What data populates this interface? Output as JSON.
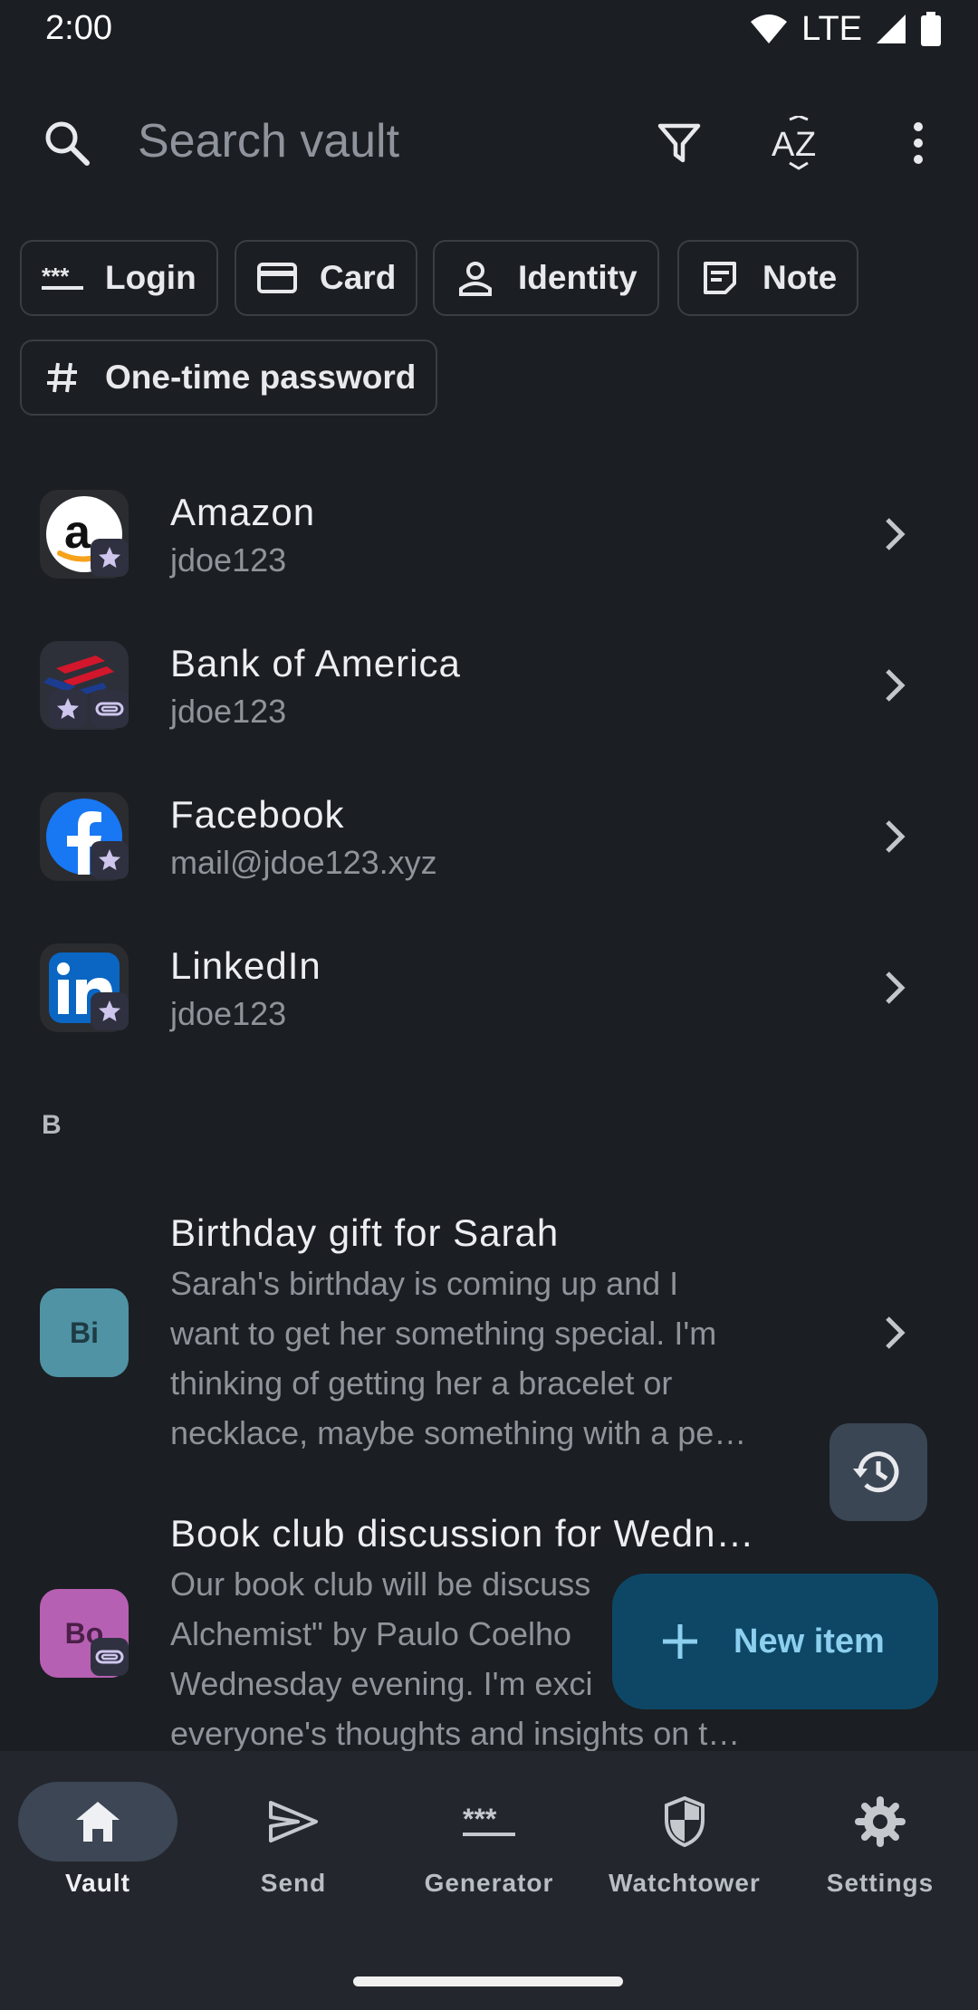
{
  "status_bar": {
    "time": "2:00",
    "network": "LTE"
  },
  "search": {
    "placeholder": "Search vault"
  },
  "toolbar": {
    "filter_icon": "filter-icon",
    "sort_icon": "sort-az-icon",
    "menu_icon": "more-vert-icon"
  },
  "chips": [
    {
      "label": "Login",
      "icon": "password-dots-icon"
    },
    {
      "label": "Card",
      "icon": "credit-card-icon"
    },
    {
      "label": "Identity",
      "icon": "person-icon"
    },
    {
      "label": "Note",
      "icon": "sticky-note-icon"
    },
    {
      "label": "One-time password",
      "icon": "hash-icon"
    }
  ],
  "logins": [
    {
      "title": "Amazon",
      "subtitle": "jdoe123",
      "icon": "amazon-logo",
      "favorite": true,
      "attachment": false
    },
    {
      "title": "Bank of America",
      "subtitle": "jdoe123",
      "icon": "bank-of-america-logo",
      "favorite": true,
      "attachment": true
    },
    {
      "title": "Facebook",
      "subtitle": "mail@jdoe123.xyz",
      "icon": "facebook-logo",
      "favorite": true,
      "attachment": false
    },
    {
      "title": "LinkedIn",
      "subtitle": "jdoe123",
      "icon": "linkedin-logo",
      "favorite": true,
      "attachment": false
    }
  ],
  "section_header": "B",
  "notes": [
    {
      "title": "Birthday gift for Sarah",
      "avatar": "Bi",
      "avatar_color": "#4f93a4",
      "lines": [
        "Sarah's birthday is coming up and I",
        "want to get her something special. I'm",
        "thinking of getting her a bracelet or",
        "necklace, maybe something with a pe…"
      ]
    },
    {
      "title": "Book club discussion for Wedn…",
      "avatar": "Bo",
      "avatar_color": "#b660b3",
      "lines": [
        "Our book club will be discuss",
        "Alchemist\" by Paulo Coelho",
        "Wednesday evening. I'm exci",
        "everyone's thoughts and insights on t…"
      ]
    }
  ],
  "fab": {
    "new_item_label": "New item"
  },
  "nav": [
    {
      "label": "Vault",
      "icon": "home-icon",
      "active": true
    },
    {
      "label": "Send",
      "icon": "send-icon",
      "active": false
    },
    {
      "label": "Generator",
      "icon": "password-dots-icon",
      "active": false
    },
    {
      "label": "Watchtower",
      "icon": "shield-icon",
      "active": false
    },
    {
      "label": "Settings",
      "icon": "gear-icon",
      "active": false
    }
  ],
  "colors": {
    "background": "#1b1e22",
    "fab": "#0e4766",
    "fab_text": "#8ccfee",
    "nav_bg": "#23272d"
  }
}
